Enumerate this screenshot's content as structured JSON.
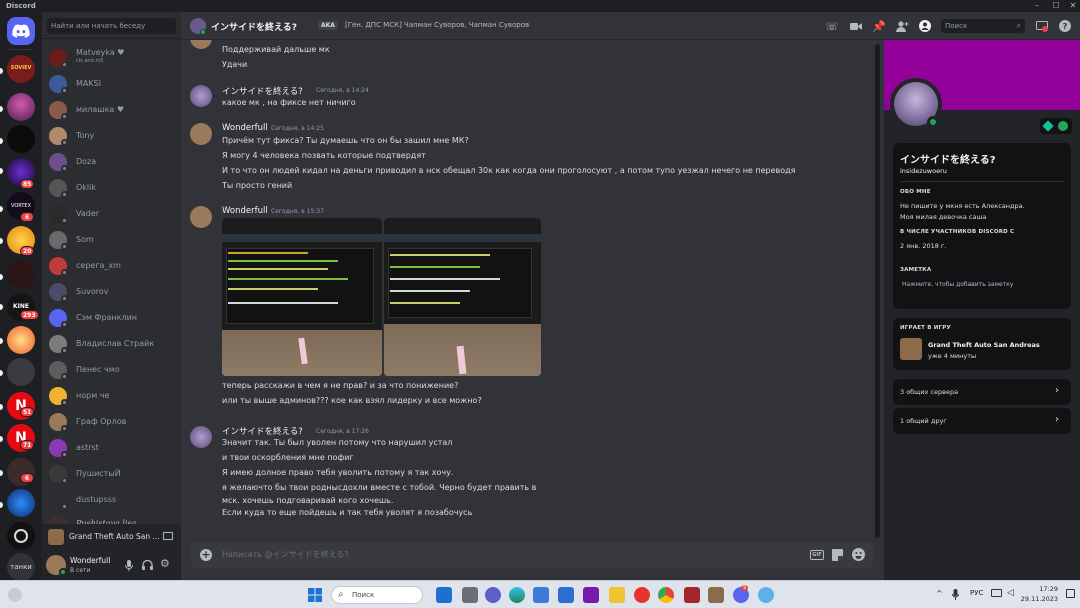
{
  "window": {
    "app_name": "Discord"
  },
  "rail": {
    "servers": [
      {
        "label": "",
        "badge": ""
      },
      {
        "label": "",
        "badge": ""
      },
      {
        "label": "",
        "badge": ""
      },
      {
        "label": "",
        "badge": ""
      },
      {
        "label": "",
        "badge": "85"
      },
      {
        "label": "VORTEX",
        "badge": "6"
      },
      {
        "label": "",
        "badge": "20"
      },
      {
        "label": "",
        "badge": ""
      },
      {
        "label": "",
        "badge": "293"
      },
      {
        "label": "",
        "badge": ""
      },
      {
        "label": "",
        "badge": ""
      },
      {
        "label": "",
        "badge": "51"
      },
      {
        "label": "",
        "badge": "71"
      },
      {
        "label": "",
        "badge": "6"
      },
      {
        "label": "",
        "badge": ""
      },
      {
        "label": "",
        "badge": ""
      },
      {
        "label": "танки",
        "badge": ""
      }
    ]
  },
  "dm_list": {
    "search_placeholder": "Найти или начать беседу",
    "items": [
      {
        "name": "Matveyka ♥",
        "status": "cls and m5 ·",
        "online": false
      },
      {
        "name": "MAKSI",
        "status": "",
        "online": false
      },
      {
        "name": "милашка ♥",
        "status": "",
        "online": false
      },
      {
        "name": "Tony",
        "status": "",
        "online": false
      },
      {
        "name": "Doza",
        "status": "",
        "online": false
      },
      {
        "name": "Oklik",
        "status": "",
        "online": false
      },
      {
        "name": "Vader",
        "status": "",
        "online": false
      },
      {
        "name": "Som",
        "status": "",
        "online": false
      },
      {
        "name": "серега_xm",
        "status": "",
        "online": false
      },
      {
        "name": "Suvorov",
        "status": "",
        "online": false
      },
      {
        "name": "Сэм Франклин",
        "status": "",
        "online": false
      },
      {
        "name": "Владислав Страйк",
        "status": "",
        "online": false
      },
      {
        "name": "Пенес чмо",
        "status": "",
        "online": false
      },
      {
        "name": "норм че",
        "status": "",
        "online": false
      },
      {
        "name": "Граф Орлов",
        "status": "",
        "online": false
      },
      {
        "name": "astrst",
        "status": "",
        "online": false
      },
      {
        "name": "ПушистыЙ",
        "status": "",
        "online": false
      },
      {
        "name": "dustupsss",
        "status": "",
        "online": false
      },
      {
        "name": "Pushistaya lisa",
        "status": "",
        "online": false
      }
    ],
    "playing_bar": "Grand Theft Auto San ...",
    "current_user": {
      "name": "Wonderfull",
      "status": "В сети"
    }
  },
  "header": {
    "channel_name": "インサイドを終える?",
    "aka_label": "AKA",
    "aka_names": "[Ген. ДПС МСК] Чапман Суворов, Чапман Суворов",
    "search_placeholder": "Поиск"
  },
  "messages": {
    "group1": {
      "lines": [
        "Поддерживай дальше мк",
        "Удачи"
      ]
    },
    "group2": {
      "author": "インサイドを終える?",
      "time": "Сегодня, в 14:24",
      "lines": [
        "какое мк , на фиксе нет ничиго"
      ]
    },
    "group3": {
      "author": "Wonderfull",
      "time": "Сегодня, в 14:25",
      "lines": [
        "Причём тут фикса? Ты думаешь что он бы зашил мне МК?",
        "Я могу 4 человека позвать которые подтвердят",
        "И то что он людей кидал на деньги приводил в нск обещал 30к как когда они проголосуют , а потом тупо уезжал нечего не переводя",
        "Ты просто гений"
      ]
    },
    "group4": {
      "author": "Wonderfull",
      "time": "Сегодня, в 15:37",
      "lines": [
        "теперь расскажи в чем я не прав? и за что понижение?",
        "или ты выше админов??? кое как взял лидерку и все можно?"
      ]
    },
    "group5": {
      "author": "インサイドを終える?",
      "time": "Сегодня, в 17:26",
      "lines": [
        "Значит так. Ты был уволен потому что нарушил устал",
        "и твои оскорбления мне пофиг",
        "Я имею долное право тебя уволить потому я так хочу.",
        "я желаючто бы твои роднысдохли вместе с тобой. Черно будет править в",
        "мск. хочешь подговаривай кого хочешь.",
        "Если куда то еще пойдешь и так тебя уволят я позабочусь"
      ]
    },
    "composer_placeholder": "Написать @インサイドを終える?"
  },
  "profile": {
    "display_name": "インサイドを終える?",
    "username": "insidezuwoeru",
    "about_label": "ОБО МНЕ",
    "about_lines": [
      "Не пишите у мкня есть Александра.",
      "Моя милая девочка саша"
    ],
    "member_since_label": "В ЧИСЛЕ УЧАСТНИКОВ DISCORD С",
    "member_since": "2 янв. 2018 г.",
    "note_label": "ЗАМЕТКА",
    "note_placeholder": "Нажмите, чтобы добавить заметку",
    "playing_label": "ИГРАЕТ В ИГРУ",
    "game_name": "Grand Theft Auto San Andreas",
    "game_time": "уже 4 минуты",
    "mutual_servers": "3 общих сервера",
    "mutual_friends": "1 общий друг"
  },
  "taskbar": {
    "search": "Поиск",
    "lang": "РУС",
    "time": "17:29",
    "date": "29.11.2023",
    "discord_badge": "9"
  }
}
